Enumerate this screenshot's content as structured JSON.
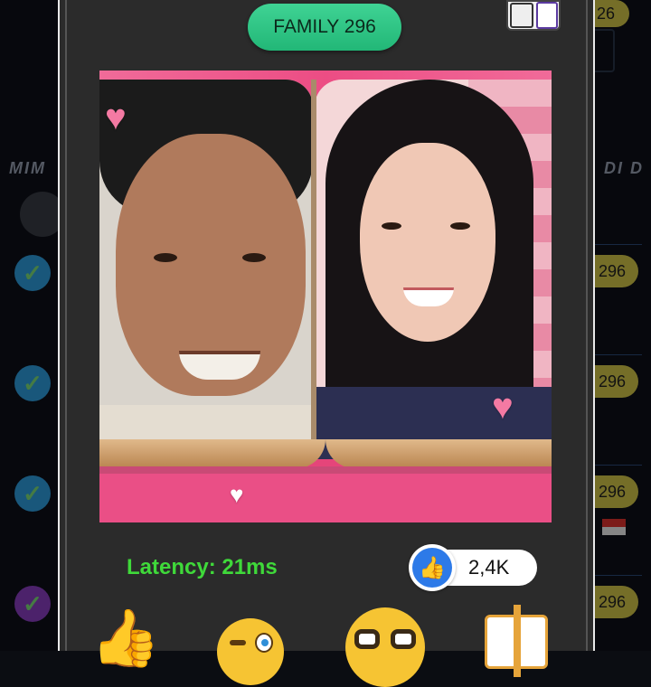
{
  "background": {
    "left_label": "MIM",
    "right_label": "DI D",
    "top_badge": "26",
    "row_badges": [
      "296",
      "296",
      "296",
      "296"
    ]
  },
  "modal": {
    "family_label": "FAMILY 296",
    "latency": "Latency: 21ms",
    "like_count": "2,4K",
    "reactions": [
      "thumbs-up",
      "winking-face",
      "nerd-face",
      "gift"
    ]
  },
  "colors": {
    "accent_green": "#22b777",
    "frame_pink": "#e5457a",
    "like_blue": "#2d7ae8",
    "latency_green": "#3fd93a"
  }
}
